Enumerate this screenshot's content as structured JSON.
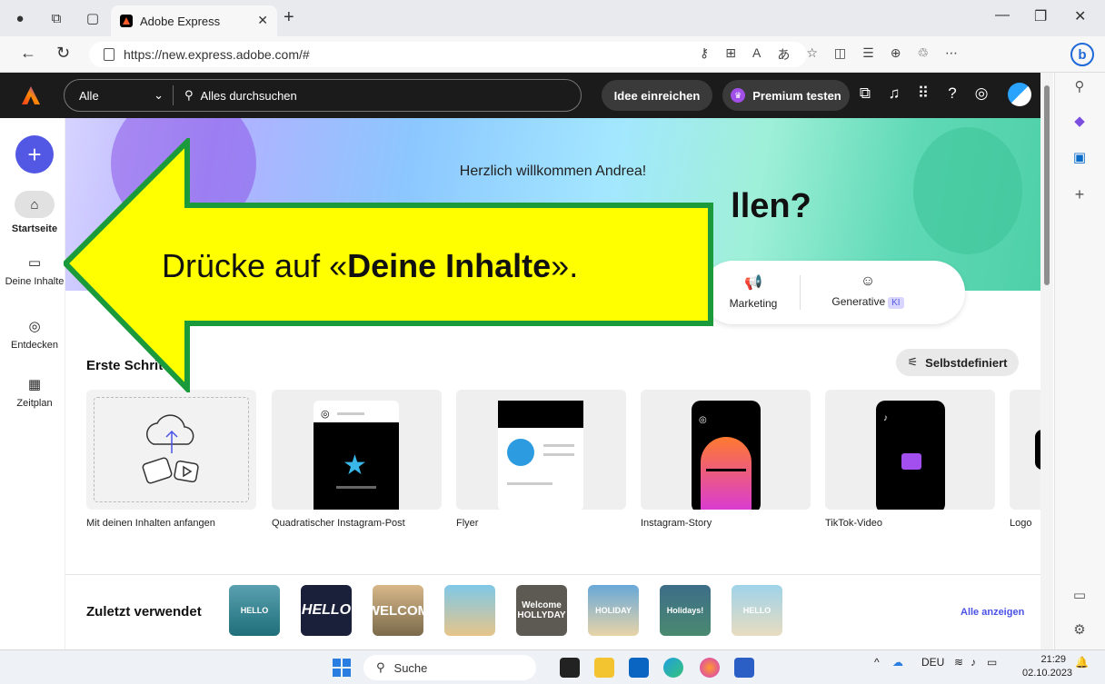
{
  "browser": {
    "tab_title": "Adobe Express",
    "url": "https://new.express.adobe.com/#"
  },
  "header": {
    "scope": "Alle",
    "search_placeholder": "Alles durchsuchen",
    "idea_button": "Idee einreichen",
    "premium_button": "Premium testen"
  },
  "leftnav": {
    "items": [
      {
        "label": "Startseite",
        "icon": "home-icon"
      },
      {
        "label": "Deine Inhalte",
        "icon": "folder-icon"
      },
      {
        "label": "Entdecken",
        "icon": "compass-icon"
      },
      {
        "label": "Zeitplan",
        "icon": "calendar-icon"
      }
    ]
  },
  "hero": {
    "welcome": "Herzlich willkommen Andrea!",
    "headline_visible": "llen?",
    "categories": [
      {
        "label": "Marketing",
        "icon": "megaphone-icon"
      },
      {
        "label": "Generative",
        "badge": "KI",
        "icon": "sparkle-face-icon"
      }
    ]
  },
  "getting_started": {
    "title": "Erste Schritte",
    "title_visible": "Erste Schritt",
    "custom_button": "Selbstdefiniert",
    "cards": [
      {
        "label": "Mit deinen Inhalten anfangen"
      },
      {
        "label": "Quadratischer Instagram-Post"
      },
      {
        "label": "Flyer"
      },
      {
        "label": "Instagram-Story"
      },
      {
        "label": "TikTok-Video"
      },
      {
        "label": "Logo"
      }
    ]
  },
  "recent": {
    "title": "Zuletzt verwendet",
    "show_all": "Alle anzeigen",
    "thumbs": [
      "HELLO",
      "HELLO",
      "WELCOM",
      "",
      "Welcome HOLLYDAY",
      "HOLIDAY",
      "Holidays!",
      "HELLO"
    ]
  },
  "callout": {
    "text_prefix": "Drücke auf «",
    "text_bold": "Deine Inhalte",
    "text_suffix": "».",
    "fill_color": "#ffff00",
    "border_color": "#1a9a3a"
  },
  "taskbar": {
    "search": "Suche",
    "lang": "DEU",
    "time": "21:29",
    "date": "02.10.2023"
  },
  "colors": {
    "accent": "#5258e4",
    "header_bg": "#1b1b1b"
  }
}
